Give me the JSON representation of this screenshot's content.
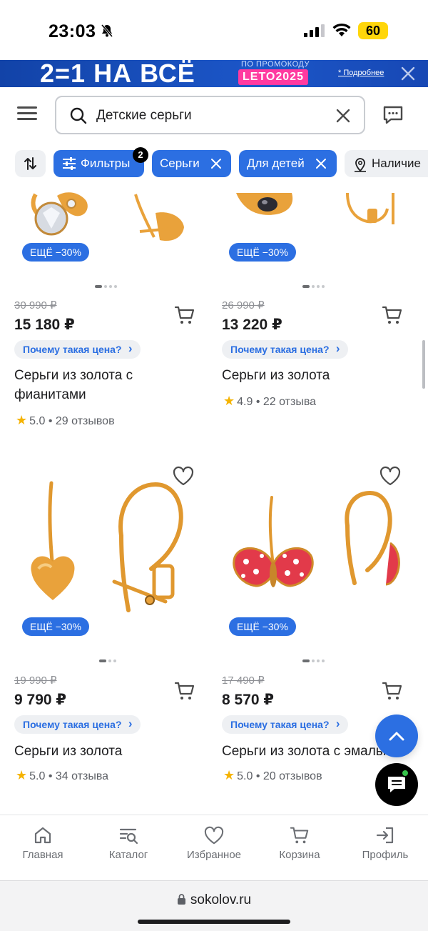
{
  "status_bar": {
    "time": "23:03",
    "battery": "60"
  },
  "promo": {
    "headline": "2=1 НА ВСЁ",
    "promo_label": "ПО ПРОМОКОДУ",
    "code": "LETO2025",
    "more_link": "* Подробнее"
  },
  "search": {
    "value": "Детские серьги"
  },
  "chips": {
    "filters": "Фильтры",
    "filters_count": "2",
    "earrings": "Серьги",
    "for_kids": "Для детей",
    "availability": "Наличие"
  },
  "products": [
    {
      "discount": "ЕЩЁ −30%",
      "old_price": "30 990 ₽",
      "price": "15 180 ₽",
      "why": "Почему такая цена?",
      "name": "Серьги из золота с фианитами",
      "rating": "5.0",
      "reviews": "29 отзывов"
    },
    {
      "discount": "ЕЩЁ −30%",
      "old_price": "26 990 ₽",
      "price": "13 220 ₽",
      "why": "Почему такая цена?",
      "name": "Серьги из золота",
      "rating": "4.9",
      "reviews": "22 отзыва"
    },
    {
      "discount": "ЕЩЁ −30%",
      "old_price": "19 990 ₽",
      "price": "9 790 ₽",
      "why": "Почему такая цена?",
      "name": "Серьги из золота",
      "rating": "5.0",
      "reviews": "34 отзыва"
    },
    {
      "discount": "ЕЩЁ −30%",
      "old_price": "17 490 ₽",
      "price": "8 570 ₽",
      "why": "Почему такая цена?",
      "name": "Серьги из золота с эмалью",
      "rating": "5.0",
      "reviews": "20 отзывов"
    }
  ],
  "bottom_nav": {
    "home": "Главная",
    "catalog": "Каталог",
    "favorites": "Избранное",
    "cart": "Корзина",
    "profile": "Профиль"
  },
  "browser": {
    "url": "sokolov.ru"
  },
  "colors": {
    "accent": "#2c6fe2",
    "promo_bg": "#1c56c8",
    "promo_code": "#ff3aa0",
    "battery": "#ffd60a",
    "gold": "#e9a23b",
    "star": "#f5b300"
  }
}
